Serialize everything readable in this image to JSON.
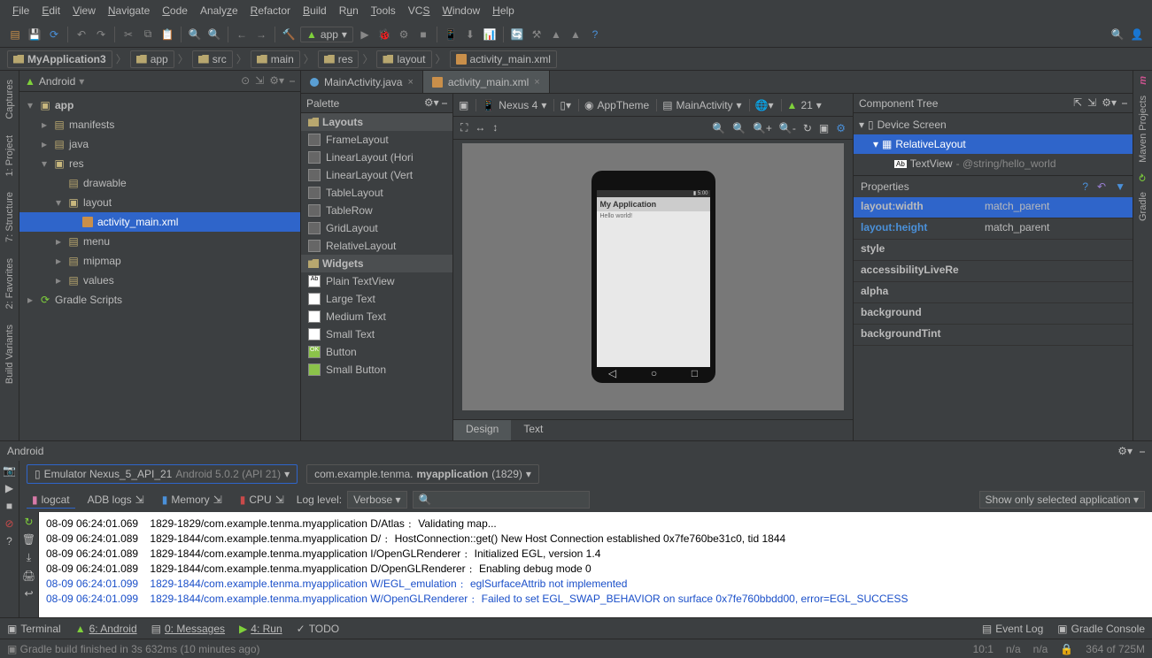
{
  "menu": [
    "File",
    "Edit",
    "View",
    "Navigate",
    "Code",
    "Analyze",
    "Refactor",
    "Build",
    "Run",
    "Tools",
    "VCS",
    "Window",
    "Help"
  ],
  "run_config": "app",
  "breadcrumb": [
    "MyApplication3",
    "app",
    "src",
    "main",
    "res",
    "layout",
    "activity_main.xml"
  ],
  "project": {
    "title": "Android",
    "root": "app",
    "nodes": {
      "manifests": "manifests",
      "java": "java",
      "res": "res",
      "drawable": "drawable",
      "layout": "layout",
      "activity_main": "activity_main.xml",
      "menu": "menu",
      "mipmap": "mipmap",
      "values": "values",
      "gradle": "Gradle Scripts"
    }
  },
  "editor": {
    "tabs": [
      {
        "label": "MainActivity.java",
        "active": false
      },
      {
        "label": "activity_main.xml",
        "active": true
      }
    ]
  },
  "palette": {
    "title": "Palette",
    "layouts_label": "Layouts",
    "layouts": [
      "FrameLayout",
      "LinearLayout (Hori",
      "LinearLayout (Vert",
      "TableLayout",
      "TableRow",
      "GridLayout",
      "RelativeLayout"
    ],
    "widgets_label": "Widgets",
    "widgets": [
      "Plain TextView",
      "Large Text",
      "Medium Text",
      "Small Text",
      "Button",
      "Small Button"
    ]
  },
  "designer": {
    "device": "Nexus 4",
    "theme": "AppTheme",
    "activity": "MainActivity",
    "api": "21",
    "app_title": "My Application",
    "hello": "Hello world!",
    "text_tab": "Text",
    "design_tab": "Design"
  },
  "ctree": {
    "title": "Component Tree",
    "device": "Device Screen",
    "rel": "RelativeLayout",
    "tv": "TextView",
    "tv_ref": "@string/hello_world"
  },
  "props": {
    "title": "Properties",
    "rows": [
      {
        "k": "layout:width",
        "v": "match_parent",
        "sel": true
      },
      {
        "k": "layout:height",
        "v": "match_parent",
        "hl": true
      },
      {
        "k": "style",
        "v": ""
      },
      {
        "k": "accessibilityLiveRe",
        "v": ""
      },
      {
        "k": "alpha",
        "v": ""
      },
      {
        "k": "background",
        "v": ""
      },
      {
        "k": "backgroundTint",
        "v": ""
      }
    ]
  },
  "android_panel": {
    "title": "Android",
    "device_label": "Emulator Nexus_5_API_21",
    "device_api": "Android 5.0.2 (API 21)",
    "process_pkg": "com.example.tenma.",
    "process_app": "myapplication",
    "process_pid": "(1829)",
    "logcat": "logcat",
    "adb": "ADB logs",
    "memory": "Memory",
    "cpu": "CPU",
    "loglevel_label": "Log level:",
    "loglevel_value": "Verbose",
    "filter": "Show only selected application",
    "search_placeholder": ""
  },
  "log": [
    {
      "t": "08-09 06:24:01.069",
      "b": "1829-1829/com.example.tenma.myapplication D/Atlas﹕ Validating map...",
      "c": ""
    },
    {
      "t": "08-09 06:24:01.089",
      "b": "1829-1844/com.example.tenma.myapplication D/﹕ HostConnection::get() New Host Connection established 0x7fe760be31c0, tid 1844",
      "c": ""
    },
    {
      "t": "08-09 06:24:01.089",
      "b": "1829-1844/com.example.tenma.myapplication I/OpenGLRenderer﹕ Initialized EGL, version 1.4",
      "c": ""
    },
    {
      "t": "08-09 06:24:01.089",
      "b": "1829-1844/com.example.tenma.myapplication D/OpenGLRenderer﹕ Enabling debug mode 0",
      "c": ""
    },
    {
      "t": "08-09 06:24:01.099",
      "b": "1829-1844/com.example.tenma.myapplication W/EGL_emulation﹕ eglSurfaceAttrib not implemented",
      "c": "blue"
    },
    {
      "t": "08-09 06:24:01.099",
      "b": "1829-1844/com.example.tenma.myapplication W/OpenGLRenderer﹕ Failed to set EGL_SWAP_BEHAVIOR on surface 0x7fe760bbdd00, error=EGL_SUCCESS",
      "c": "blue"
    }
  ],
  "bottombar": {
    "terminal": "Terminal",
    "android": "6: Android",
    "messages": "0: Messages",
    "run": "4: Run",
    "todo": "TODO",
    "eventlog": "Event Log",
    "gradle": "Gradle Console"
  },
  "status": {
    "msg": "Gradle build finished in 3s 632ms (10 minutes ago)",
    "pos": "10:1",
    "na1": "n/a",
    "na2": "n/a",
    "mem": "364 of 725M"
  },
  "sidetabs": {
    "captures": "Captures",
    "project": "1: Project",
    "structure": "7: Structure",
    "favorites": "2: Favorites",
    "build": "Build Variants",
    "maven": "Maven Projects",
    "gradle": "Gradle"
  }
}
